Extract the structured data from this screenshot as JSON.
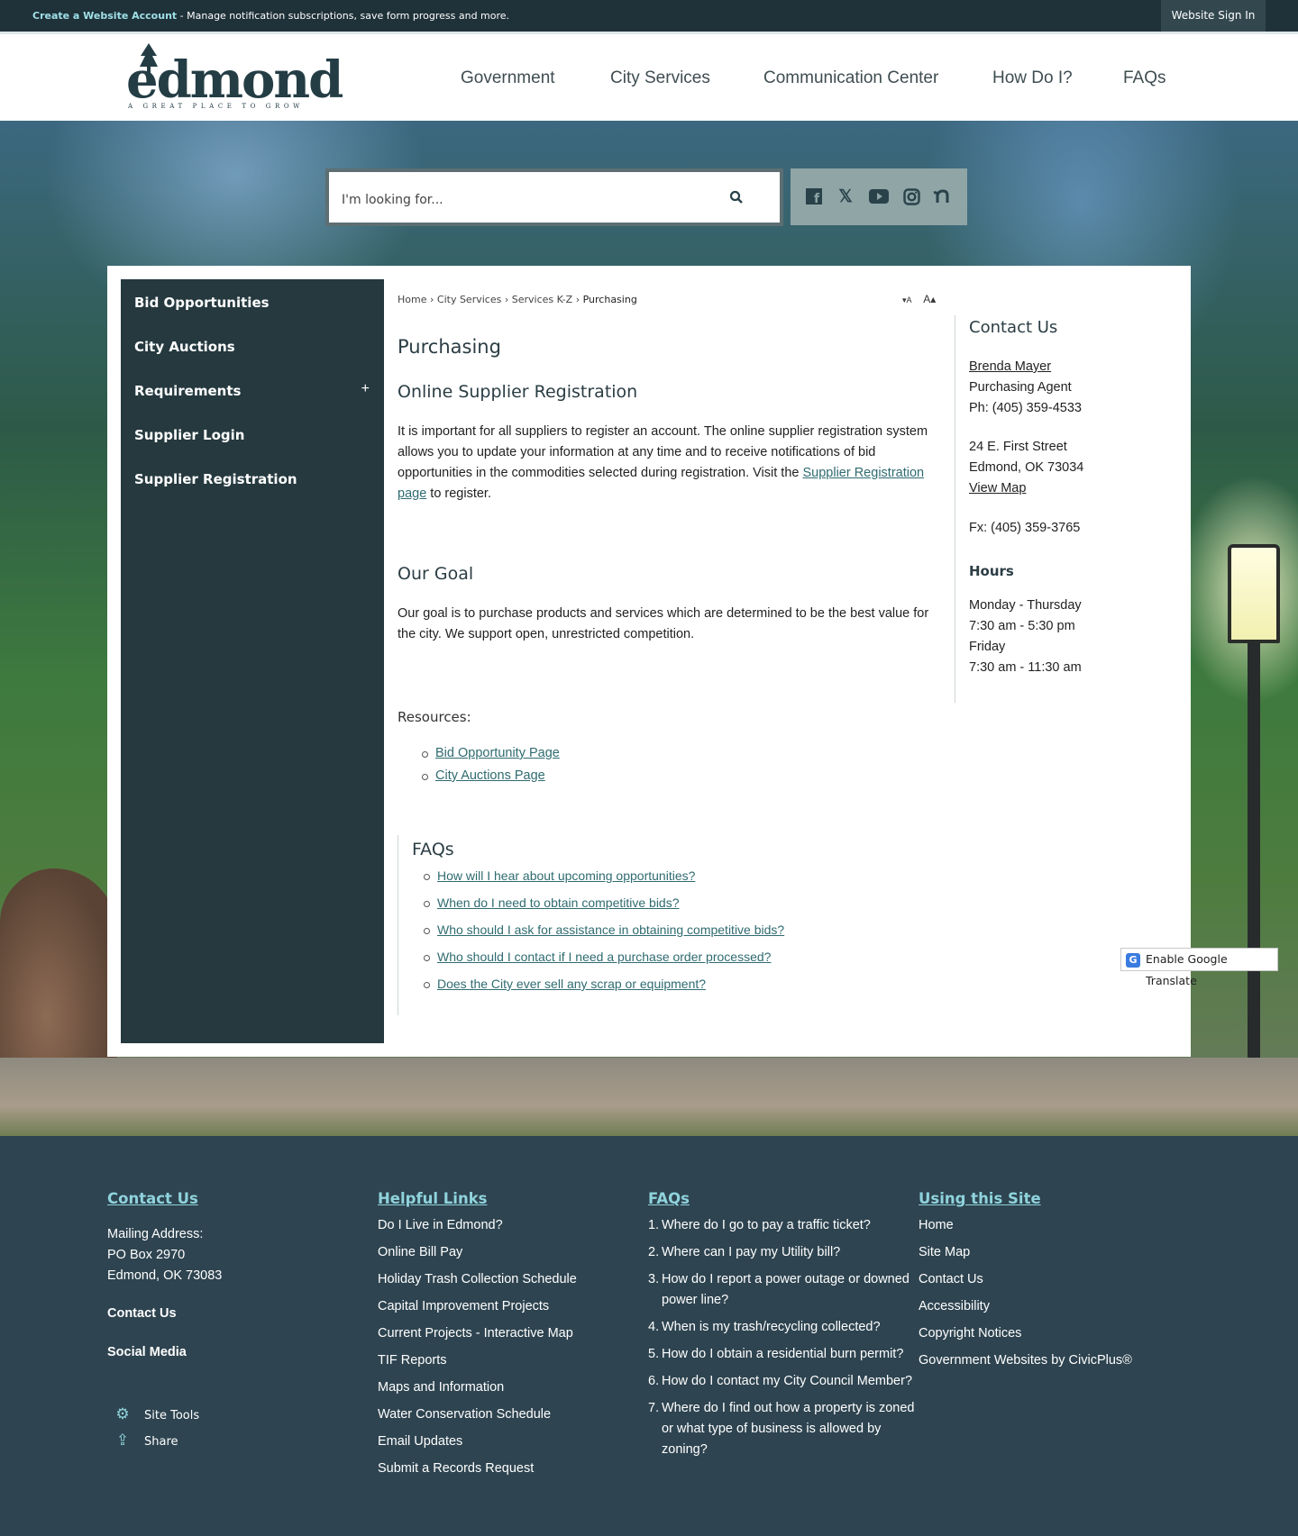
{
  "topbar": {
    "account_link": "Create a Website Account",
    "message": " - Manage notification subscriptions, save form progress and more.",
    "sign_in": "Website Sign In"
  },
  "logo": {
    "name": "edmond",
    "tagline": "A GREAT PLACE TO GROW"
  },
  "nav": [
    "Government",
    "City Services",
    "Communication Center",
    "How Do I?",
    "FAQs"
  ],
  "search": {
    "placeholder": "I'm looking for..."
  },
  "social": [
    "facebook-icon",
    "x-icon",
    "youtube-icon",
    "instagram-icon",
    "nextdoor-icon"
  ],
  "sidenav": {
    "items": [
      "Bid Opportunities",
      "City Auctions",
      "Requirements",
      "Supplier Login",
      "Supplier Registration"
    ],
    "expand_symbol": "+"
  },
  "breadcrumb": {
    "items": [
      "Home",
      "City Services",
      "Services K-Z"
    ],
    "current": "Purchasing",
    "separator": "›"
  },
  "font_controls": {
    "decrease": "▾A",
    "increase": "A▴"
  },
  "main": {
    "title": "Purchasing",
    "section1_title": "Online Supplier Registration",
    "section1_text": "It is important for all suppliers to register an account. The online supplier registration system allows you to update your information at any time and to receive notifications of bid opportunities in the commodities selected during registration. Visit the ",
    "section1_link": "Supplier Registration page",
    "section1_end": " to register.",
    "section2_title": "Our Goal",
    "section2_text": "Our goal is to purchase products and services which are determined to be the best value for the city. We support open, unrestricted competition.",
    "resources_title": "Resources:",
    "resources": [
      "Bid Opportunity Page",
      "City Auctions Page"
    ],
    "faqs_title": "FAQs",
    "faqs": [
      "How will I hear about upcoming opportunities?",
      "When do I need to obtain competitive bids?",
      "Who should I ask for assistance in obtaining competitive bids?",
      "Who should I contact if I need a purchase order processed?",
      "Does the City ever sell any scrap or equipment?"
    ]
  },
  "aside": {
    "title": "Contact Us",
    "name": "Brenda Mayer",
    "role": "Purchasing Agent",
    "phone": "Ph: (405) 359-4533",
    "address1": "24 E. First Street",
    "address2": "Edmond, OK 73034",
    "map_link": "View Map",
    "fax": "Fx: (405) 359-3765",
    "hours_title": "Hours",
    "hours": [
      "Monday - Thursday",
      "7:30 am - 5:30 pm",
      "Friday",
      "7:30 am - 11:30 am"
    ]
  },
  "translate": {
    "label": "Enable Google Translate",
    "icon": "G"
  },
  "footer": {
    "contact": {
      "title": "Contact Us",
      "mailing": [
        "Mailing Address:",
        "PO Box 2970",
        "Edmond, OK 73083"
      ],
      "contact_link": "Contact Us",
      "social_link": "Social Media",
      "site_tools": "Site Tools",
      "share": "Share"
    },
    "helpful": {
      "title": "Helpful Links",
      "items": [
        "Do I Live in Edmond?",
        "Online Bill Pay",
        "Holiday Trash Collection Schedule",
        "Capital Improvement Projects",
        "Current Projects - Interactive Map",
        "TIF Reports",
        "Maps and Information",
        "Water Conservation Schedule",
        "Email Updates",
        "Submit a Records Request"
      ]
    },
    "faqs": {
      "title": "FAQs",
      "items": [
        "Where do I go to pay a traffic ticket?",
        "Where can I pay my Utility bill?",
        "How do I report a power outage or downed power line?",
        "When is my trash/recycling collected?",
        "How do I obtain a residential burn permit?",
        "How do I contact my City Council Member?",
        "Where do I find out how a property is zoned or what type of business is allowed by zoning?"
      ]
    },
    "using": {
      "title": "Using this Site",
      "items": [
        "Home",
        "Site Map",
        "Contact Us",
        "Accessibility",
        "Copyright Notices",
        "Government Websites by CivicPlus®"
      ]
    }
  }
}
